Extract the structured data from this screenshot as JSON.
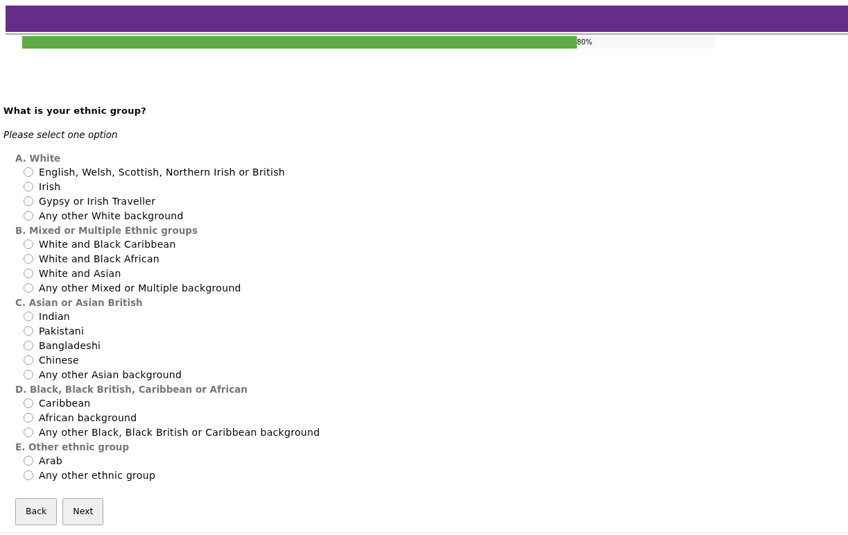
{
  "progress": {
    "level": 0.8,
    "label": "80%"
  },
  "question": {
    "title": "What is your ethnic group?",
    "instruction": "Please select one option",
    "groups": [
      {
        "label": "A. White",
        "options": [
          {
            "label": "English, Welsh, Scottish, Northern Irish or British",
            "selected": false
          },
          {
            "label": "Irish",
            "selected": false
          },
          {
            "label": "Gypsy or Irish Traveller",
            "selected": false
          },
          {
            "label": "Any other White background",
            "selected": false
          }
        ]
      },
      {
        "label": "B. Mixed or Multiple Ethnic groups",
        "options": [
          {
            "label": "White and Black Caribbean",
            "selected": false
          },
          {
            "label": "White and Black African",
            "selected": false
          },
          {
            "label": "White and Asian",
            "selected": false
          },
          {
            "label": "Any other Mixed or Multiple background",
            "selected": false
          }
        ]
      },
      {
        "label": "C. Asian or Asian British",
        "options": [
          {
            "label": "Indian",
            "selected": false
          },
          {
            "label": "Pakistani",
            "selected": false
          },
          {
            "label": "Bangladeshi",
            "selected": false
          },
          {
            "label": "Chinese",
            "selected": false
          },
          {
            "label": "Any other Asian background",
            "selected": false
          }
        ]
      },
      {
        "label": "D. Black, Black British, Caribbean or African",
        "options": [
          {
            "label": "Caribbean",
            "selected": false
          },
          {
            "label": "African background",
            "selected": false
          },
          {
            "label": "Any other Black, Black British or Caribbean background",
            "selected": false
          }
        ]
      },
      {
        "label": "E. Other ethnic group",
        "options": [
          {
            "label": "Arab",
            "selected": false
          },
          {
            "label": "Any other ethnic group",
            "selected": false
          }
        ]
      }
    ]
  },
  "buttons": [
    "Back",
    "Next"
  ]
}
